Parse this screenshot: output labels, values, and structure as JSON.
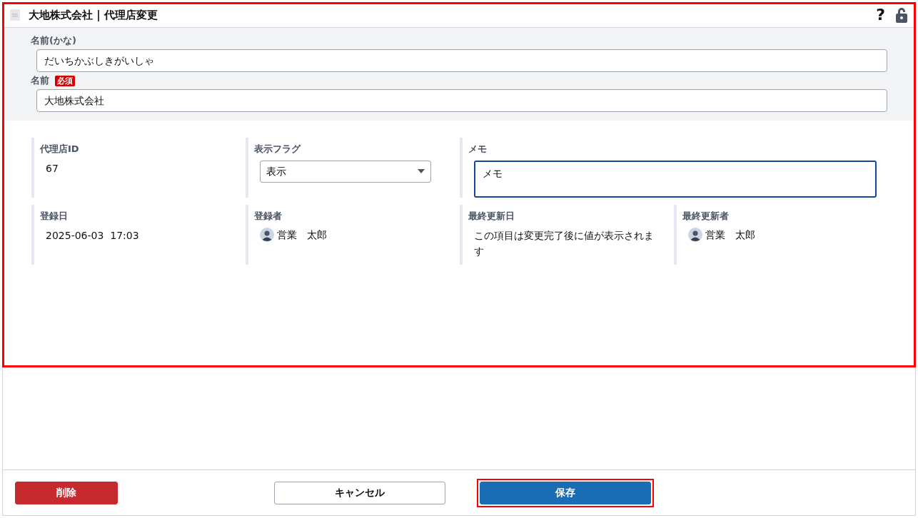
{
  "window": {
    "title": "大地株式会社 | 代理店変更"
  },
  "name_section": [
    {
      "label": "名前(かな)",
      "value": "だいちかぶしきがいしゃ"
    },
    {
      "label": "名前",
      "required_badge": "必須",
      "value": "大地株式会社"
    }
  ],
  "form_highlighted": true,
  "fields": [
    {
      "kind": "text",
      "label": "代理店ID",
      "value": "67"
    },
    {
      "kind": "select",
      "label": "表示フラグ",
      "value": "表示"
    },
    {
      "kind": "textarea",
      "label": "メモ",
      "value": "メモ",
      "focused": true
    },
    {
      "kind": "text",
      "label": "登録日",
      "value": "2025-06-03  17:03"
    },
    {
      "kind": "user",
      "label": "登録者",
      "value": "営業　太郎"
    },
    {
      "kind": "text",
      "label": "最終更新日",
      "value": "この項目は変更完了後に値が表示されます"
    },
    {
      "kind": "user",
      "label": "最終更新者",
      "value": "営業　太郎"
    }
  ],
  "help": "?",
  "buttons": [
    {
      "kind": "danger",
      "label": "削除",
      "highlighted": false
    },
    {
      "kind": "secondary",
      "label": "キャンセル",
      "highlighted": false
    },
    {
      "kind": "primary",
      "label": "保存",
      "highlighted": true
    }
  ]
}
